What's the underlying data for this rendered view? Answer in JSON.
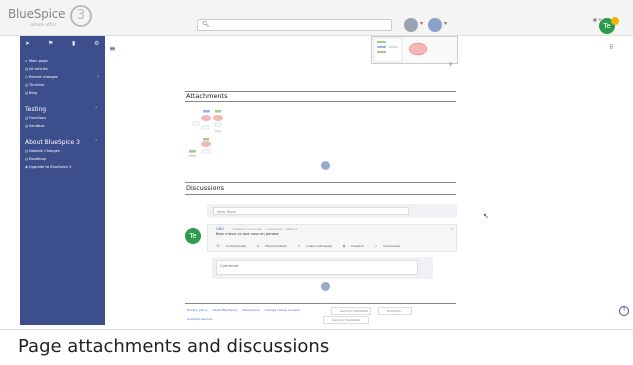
{
  "logo": {
    "brand": "BlueSpice",
    "version": "3",
    "tagline": "remote office"
  },
  "search": {
    "placeholder": ""
  },
  "topbar": {
    "misc": "■ ☰"
  },
  "user": {
    "initials": "Te"
  },
  "sidebar": {
    "main_items": [
      {
        "label": "Main page",
        "icon": "home-icon",
        "glyph": "⌂"
      },
      {
        "label": "All articles",
        "icon": "list-icon",
        "glyph": "▤"
      },
      {
        "label": "Recent changes",
        "icon": "clock-icon",
        "glyph": "◷",
        "has_caret": true
      },
      {
        "label": "Timeline",
        "icon": "timeline-icon",
        "glyph": "▤"
      },
      {
        "label": "Blog",
        "icon": "blog-icon",
        "glyph": "▤"
      }
    ],
    "group_testing": {
      "title": "Testing",
      "items": [
        "Functions",
        "Sandbox"
      ]
    },
    "group_about": {
      "title": "About BlueSpice 3",
      "items": [
        "Notable Changes",
        "Roadmap",
        "Upgrade to BlueSpice 3"
      ]
    }
  },
  "content": {
    "attachments_heading": "Attachments",
    "discussions_heading": "Discussions",
    "more_label": "⋯",
    "new_topic_placeholder": "New Topic",
    "topic": {
      "author": "UNO",
      "meta": "created 2 hours ago ·  1 answer(s)   ·  Sabrina",
      "text": "Bien mieux ce que vous en pensez",
      "actions": [
        "Comments(0)",
        "Placements(0)",
        "Linked articles(0)",
        "Unwatch",
        "Unresolved"
      ],
      "close": "×"
    },
    "comment_placeholder": "Comment"
  },
  "footer": {
    "links": [
      "Privacy policy",
      "About BlueSpice",
      "Disclaimers",
      "Change cookie consent"
    ],
    "analytics": "Analytics service",
    "badges": [
      "Semantic MediaWiki",
      "BlueSpice",
      "Semantic MediaWiki"
    ]
  },
  "caption": "Page attachments and discussions",
  "colors": {
    "sidebar": "#3c4e8c",
    "accent": "#3c6ec9",
    "avatar": "#2e9a4d"
  }
}
